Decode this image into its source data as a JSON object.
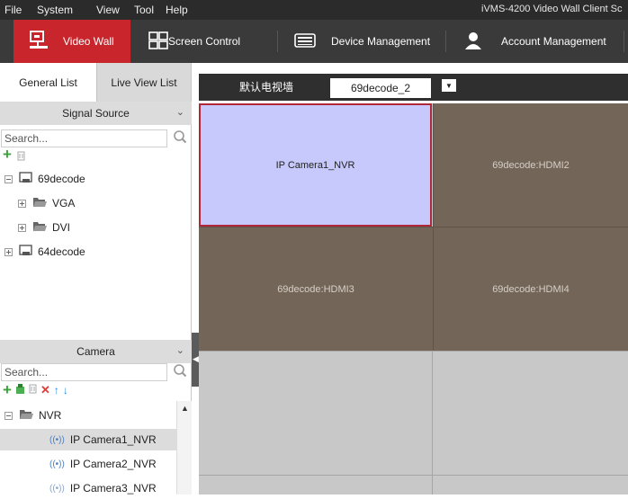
{
  "menu": [
    "File",
    "System",
    "View",
    "Tool",
    "Help"
  ],
  "app_title": "iVMS-4200 Video Wall Client Sc",
  "nav": {
    "tabs": [
      {
        "label": "Video Wall",
        "icon": "video-wall-icon",
        "active": true
      },
      {
        "label": "Screen Control",
        "icon": "screen-control-icon",
        "active": false
      },
      {
        "label": "Device Management",
        "icon": "device-management-icon",
        "active": false
      },
      {
        "label": "Account Management",
        "icon": "account-icon",
        "active": false
      }
    ],
    "active_color": "#c8262c"
  },
  "left_panel": {
    "tabs": [
      {
        "label": "General List",
        "active": true
      },
      {
        "label": "Live View List",
        "active": false
      }
    ],
    "signal_source": {
      "title": "Signal Source",
      "search_placeholder": "Search...",
      "tree": [
        {
          "label": "69decode",
          "expanded": true
        },
        {
          "label": "VGA"
        },
        {
          "label": "DVI"
        },
        {
          "label": "64decode",
          "expanded": false
        }
      ]
    },
    "camera": {
      "title": "Camera",
      "search_placeholder": "Search...",
      "group": "NVR",
      "items": [
        {
          "label": "IP Camera1_NVR",
          "selected": true
        },
        {
          "label": "IP Camera2_NVR",
          "selected": false
        },
        {
          "label": "IP Camera3_NVR",
          "selected": false
        }
      ]
    }
  },
  "wall": {
    "name": "默认电视墙",
    "decoder": "69decode_2",
    "cells": [
      {
        "label": "IP Camera1_NVR",
        "state": "selected"
      },
      {
        "label": "69decode:HDMI2",
        "state": "bound"
      },
      {
        "label": "69decode:HDMI3",
        "state": "bound"
      },
      {
        "label": "69decode:HDMI4",
        "state": "bound"
      },
      {
        "label": "",
        "state": "empty"
      },
      {
        "label": "",
        "state": "empty"
      },
      {
        "label": "",
        "state": "empty"
      },
      {
        "label": "",
        "state": "empty"
      }
    ],
    "colors": {
      "selected_fill": "#c7c8fb",
      "selected_border": "#b0263a",
      "bound_fill": "#736659",
      "empty_fill": "#c8c8c8"
    }
  }
}
